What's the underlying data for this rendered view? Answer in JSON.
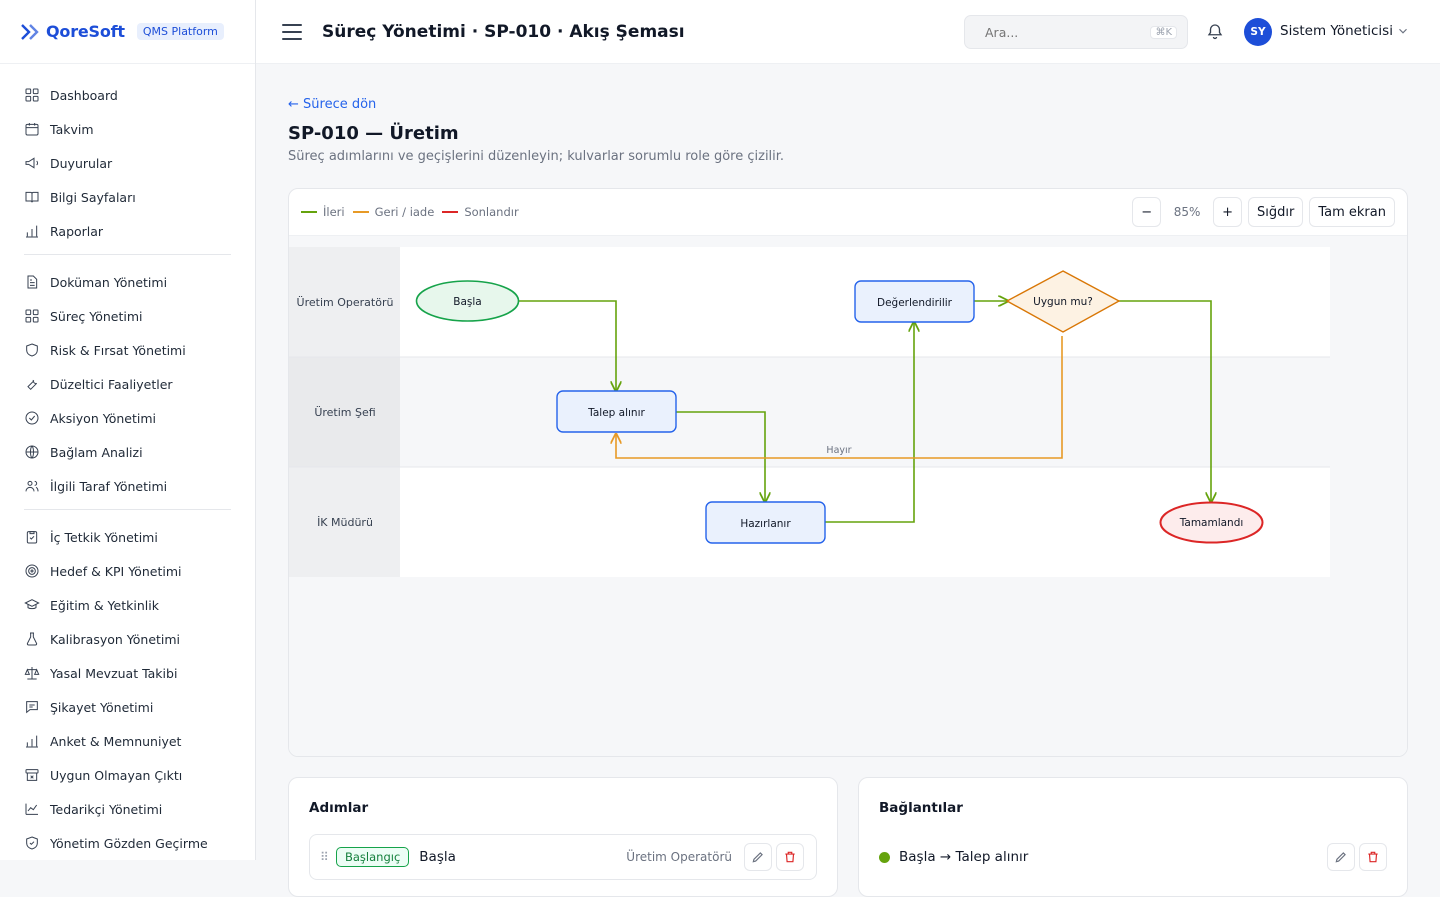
{
  "brand": {
    "name": "QoreSoft",
    "badge": "QMS Platform"
  },
  "topbar": {
    "heading": "Süreç Yönetimi · SP-010 · Akış Şeması",
    "search_placeholder": "Ara...",
    "search_shortcut": "⌘K",
    "user_initials": "SY",
    "user_name": "Sistem Yöneticisi"
  },
  "sidebar": {
    "groups": [
      [
        {
          "label": "Dashboard",
          "icon": "grid-icon"
        },
        {
          "label": "Takvim",
          "icon": "calendar-icon"
        },
        {
          "label": "Duyurular",
          "icon": "megaphone-icon"
        },
        {
          "label": "Bilgi Sayfaları",
          "icon": "book-icon"
        },
        {
          "label": "Raporlar",
          "icon": "bar-chart-icon"
        }
      ],
      [
        {
          "label": "Doküman Yönetimi",
          "icon": "document-icon"
        },
        {
          "label": "Süreç Yönetimi",
          "icon": "grid-icon"
        },
        {
          "label": "Risk & Fırsat Yönetimi",
          "icon": "shield-icon"
        },
        {
          "label": "Düzeltici Faaliyetler",
          "icon": "wrench-icon"
        },
        {
          "label": "Aksiyon Yönetimi",
          "icon": "check-circle-icon"
        },
        {
          "label": "Bağlam Analizi",
          "icon": "globe-icon"
        },
        {
          "label": "İlgili Taraf Yönetimi",
          "icon": "users-icon"
        }
      ],
      [
        {
          "label": "İç Tetkik Yönetimi",
          "icon": "clipboard-icon"
        },
        {
          "label": "Hedef & KPI Yönetimi",
          "icon": "target-icon"
        },
        {
          "label": "Eğitim & Yetkinlik",
          "icon": "graduation-cap-icon"
        },
        {
          "label": "Kalibrasyon Yönetimi",
          "icon": "flask-icon"
        },
        {
          "label": "Yasal Mevzuat Takibi",
          "icon": "scale-icon"
        },
        {
          "label": "Şikayet Yönetimi",
          "icon": "message-icon"
        },
        {
          "label": "Anket & Memnuniyet",
          "icon": "bar-chart-icon"
        },
        {
          "label": "Uygun Olmayan Çıktı",
          "icon": "archive-x-icon"
        },
        {
          "label": "Tedarikçi Yönetimi",
          "icon": "line-chart-icon"
        },
        {
          "label": "Yönetim Gözden Geçirme",
          "icon": "shield-check-icon"
        }
      ]
    ]
  },
  "page": {
    "back_link": "← Sürece dön",
    "title": "SP-010 — Üretim",
    "subtitle": "Süreç adımlarını ve geçişlerini düzenleyin; kulvarlar sorumlu role göre çizilir."
  },
  "legend": [
    {
      "label": "İleri",
      "color": "#65a30d"
    },
    {
      "label": "Geri / iade",
      "color": "#e79a26"
    },
    {
      "label": "Sonlandır",
      "color": "#dc2626"
    }
  ],
  "toolbar": {
    "zoom_out": "−",
    "zoom_level": "85%",
    "zoom_in": "+",
    "fit": "Sığdır",
    "fullscreen": "Tam ekran"
  },
  "diagram": {
    "lanes": [
      "Üretim Operatörü",
      "Üretim Şefi",
      "İK Müdürü"
    ],
    "nodes": [
      {
        "label": "Başla",
        "shape": "start"
      },
      {
        "label": "Talep alınır",
        "shape": "task"
      },
      {
        "label": "Hazırlanır",
        "shape": "task"
      },
      {
        "label": "Değerlendirilir",
        "shape": "task"
      },
      {
        "label": "Uygun mu?",
        "shape": "decision"
      },
      {
        "label": "Tamamlandı",
        "shape": "end"
      }
    ],
    "edge_labels": {
      "return": "Hayır"
    }
  },
  "steps_panel": {
    "title": "Adımlar",
    "first_step": {
      "badge": "Başlangıç",
      "name": "Başla",
      "role": "Üretim Operatörü"
    }
  },
  "connections_panel": {
    "title": "Bağlantılar",
    "first_connection": "Başla → Talep alınır"
  }
}
